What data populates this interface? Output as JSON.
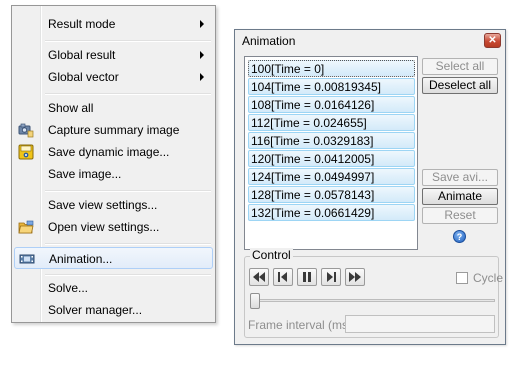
{
  "context_menu": {
    "items": [
      {
        "label": "Result mode",
        "submenu": true
      },
      {
        "label": "Global result",
        "submenu": true
      },
      {
        "label": "Global vector",
        "submenu": true
      },
      {
        "label": "Show all"
      },
      {
        "label": "Capture summary image",
        "icon": "camera-icon"
      },
      {
        "label": "Save dynamic image...",
        "icon": "save-dynamic-image-icon"
      },
      {
        "label": "Save image..."
      },
      {
        "label": "Save view settings..."
      },
      {
        "label": "Open view settings...",
        "icon": "open-folder-icon"
      },
      {
        "label": "Animation...",
        "icon": "film-icon",
        "highlighted": true
      },
      {
        "label": "Solve..."
      },
      {
        "label": "Solver manager..."
      }
    ]
  },
  "dialog": {
    "title": "Animation",
    "close_icon": "close-icon",
    "frames": [
      "100[Time = 0]",
      "104[Time = 0.00819345]",
      "108[Time = 0.0164126]",
      "112[Time = 0.024655]",
      "116[Time = 0.0329183]",
      "120[Time = 0.0412005]",
      "124[Time = 0.0494997]",
      "128[Time = 0.0578143]",
      "132[Time = 0.0661429]"
    ],
    "buttons": {
      "select_all": "Select all",
      "deselect_all": "Deselect all",
      "save_avi": "Save avi...",
      "animate": "Animate",
      "reset": "Reset"
    },
    "control": {
      "label": "Control",
      "playback_icons": [
        "skip-to-start-icon",
        "step-back-icon",
        "pause-icon",
        "step-forward-icon",
        "skip-to-end-icon"
      ],
      "cycle_label": "Cycle",
      "cycle_checked": false,
      "slider_position": 0,
      "frame_interval_label": "Frame interval (ms)",
      "frame_interval_value": ""
    },
    "colors": {
      "selection_fill": "#d3eaf9",
      "selection_border": "#9dd5f4",
      "close_button": "#c84a34"
    }
  }
}
